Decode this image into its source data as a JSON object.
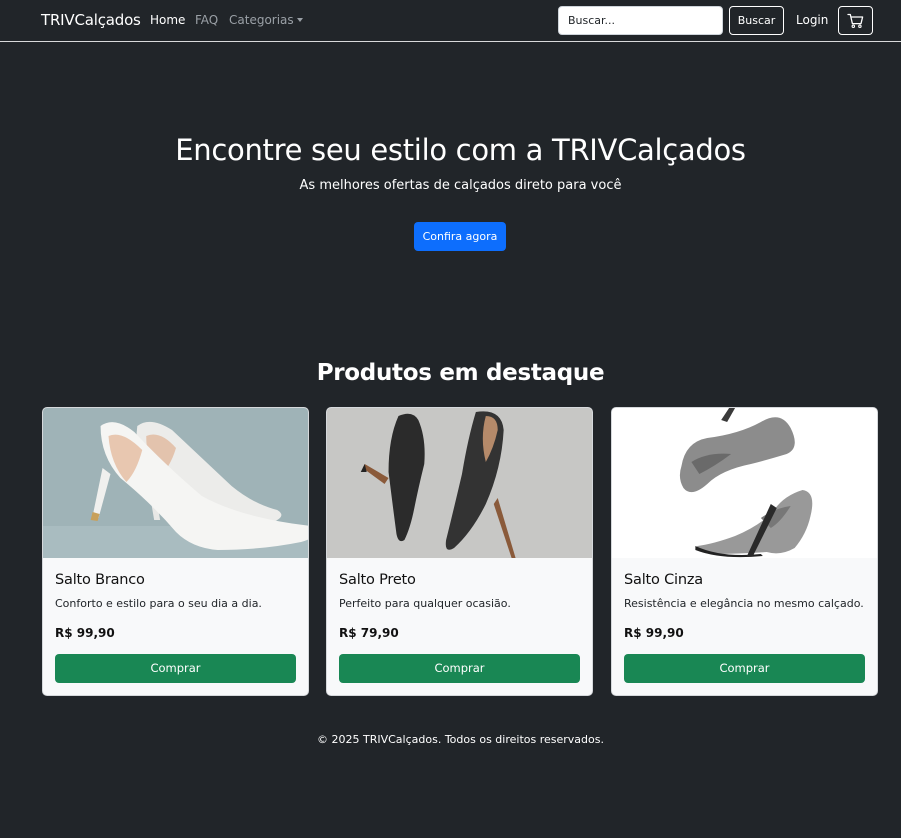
{
  "navbar": {
    "brand": "TRIVCalçados",
    "links": [
      {
        "label": "Home"
      },
      {
        "label": "FAQ"
      },
      {
        "label": "Categorias"
      }
    ],
    "search": {
      "placeholder": "Buscar...",
      "button_label": "Buscar"
    },
    "login_label": "Login",
    "cart_icon": "cart-icon"
  },
  "hero": {
    "title": "Encontre seu estilo com a TRIVCalçados",
    "subtitle": "As melhores ofertas de calçados direto para você",
    "cta_label": "Confira agora"
  },
  "products": {
    "section_title": "Produtos em destaque",
    "items": [
      {
        "name": "Salto Branco",
        "description": "Conforto e estilo para o seu dia a dia.",
        "price": "R$ 99,90",
        "button_label": "Comprar"
      },
      {
        "name": "Salto Preto",
        "description": "Perfeito para qualquer ocasião.",
        "price": "R$ 79,90",
        "button_label": "Comprar"
      },
      {
        "name": "Salto Cinza",
        "description": "Resistência e elegância no mesmo calçado.",
        "price": "R$ 99,90",
        "button_label": "Comprar"
      }
    ]
  },
  "footer": {
    "text": "© 2025 TRIVCalçados. Todos os direitos reservados."
  },
  "colors": {
    "background": "#212529",
    "primary": "#0d6efd",
    "success": "#198754",
    "card_background": "#f8f9fa"
  }
}
